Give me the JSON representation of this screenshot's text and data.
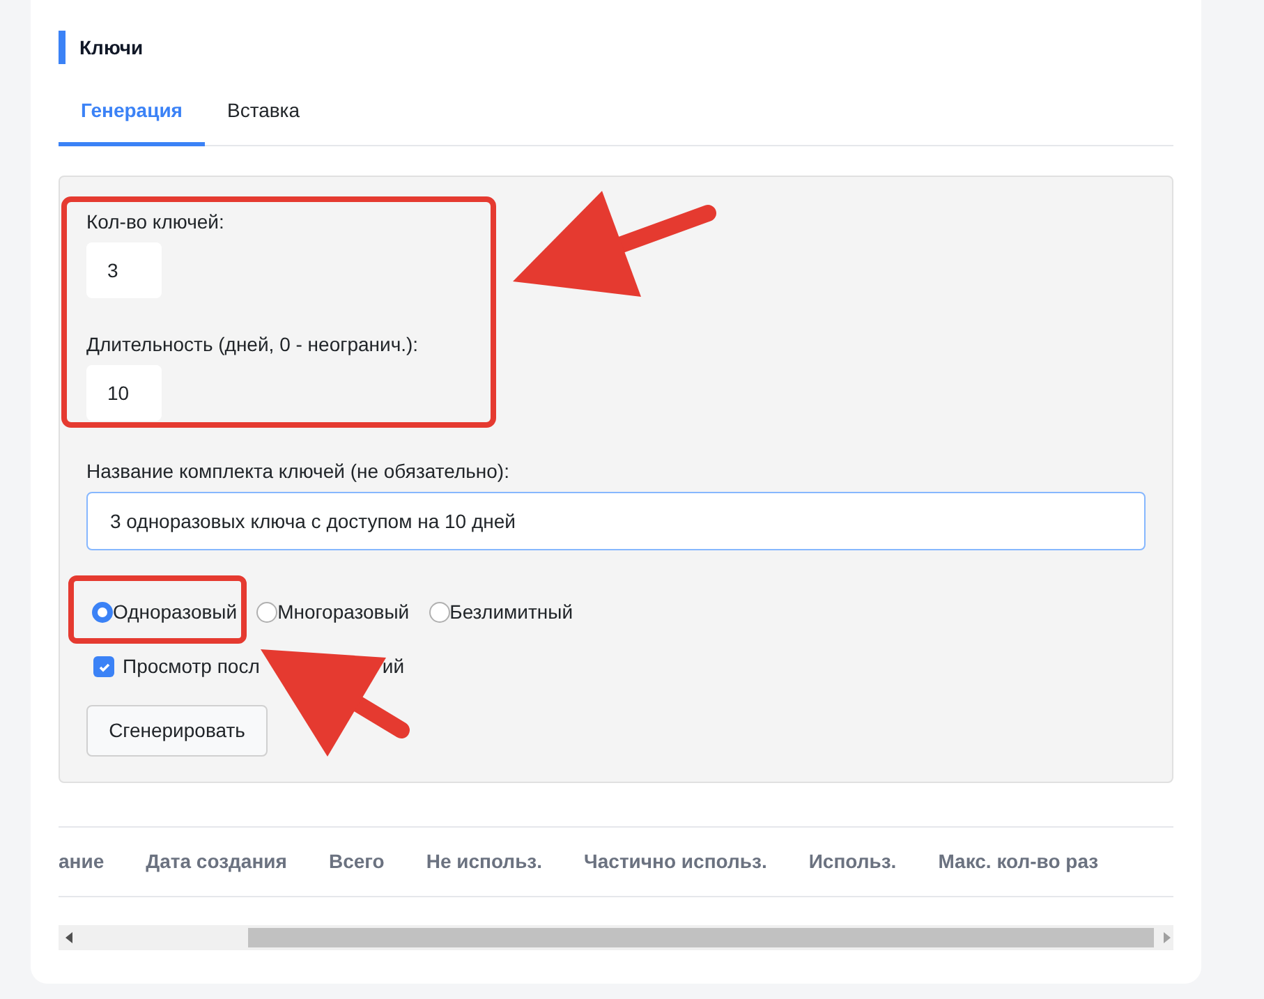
{
  "section": {
    "title": "Ключи"
  },
  "tabs": [
    {
      "label": "Генерация",
      "selected": true
    },
    {
      "label": "Вставка",
      "selected": false
    }
  ],
  "form": {
    "count": {
      "label": "Кол-во ключей:",
      "value": "3"
    },
    "duration": {
      "label": "Длительность (дней, 0 - неогранич.):",
      "value": "10"
    },
    "name": {
      "label": "Название комплекта ключей (не обязательно):",
      "value": "3 одноразовых ключа с доступом на 10 дней"
    },
    "key_types": [
      {
        "label": "Одноразовый",
        "selected": true
      },
      {
        "label": "Многоразовый",
        "selected": false
      },
      {
        "label": "Безлимитный",
        "selected": false
      }
    ],
    "view_option": {
      "label_start": "Просмотр посл",
      "label_end": "ий",
      "checked": true
    },
    "generate_button": "Сгенерировать"
  },
  "table": {
    "columns": [
      "ание",
      "Дата создания",
      "Всего",
      "Не использ.",
      "Частично использ.",
      "Использ.",
      "Макс. кол-во раз"
    ]
  }
}
